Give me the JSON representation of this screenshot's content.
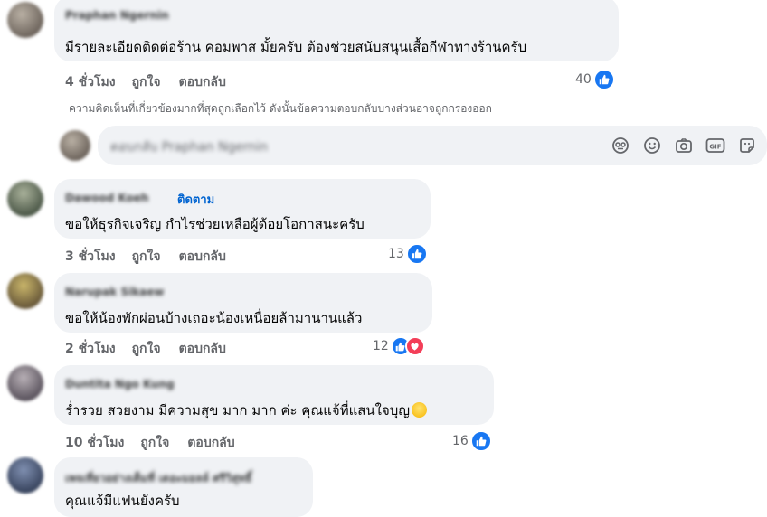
{
  "comments": [
    {
      "author": "Praphan Ngernin",
      "text": "มีรายละเอียดติดต่อร้าน คอมพาส มั้ยครับ ต้องช่วยสนับสนุนเสื้อกีฬาทางร้านครับ",
      "time": "4 ชั่วโมง",
      "like": "ถูกใจ",
      "reply": "ตอบกลับ",
      "reactions": "40"
    },
    {
      "author": "Dawood Koeh",
      "follow": "ติดตาม",
      "text": "ขอให้ธุรกิจเจริญ กำไรช่วยเหลือผู้ด้อยโอกาสนะครับ",
      "time": "3 ชั่วโมง",
      "like": "ถูกใจ",
      "reply": "ตอบกลับ",
      "reactions": "13"
    },
    {
      "author": "Narupak Sikaew",
      "text": "ขอให้น้องพักผ่อนบ้างเถอะน้องเหนื่อยล้ามานานแล้ว",
      "time": "2 ชั่วโมง",
      "like": "ถูกใจ",
      "reply": "ตอบกลับ",
      "reactions": "12"
    },
    {
      "author": "Duntita Ngo Kung",
      "text": "ร่ำรวย สวยงาม มีความสุข มาก มาก ค่ะ คุณแจ้ที่แสนใจบุญ",
      "time": "10 ชั่วโมง",
      "like": "ถูกใจ",
      "reply": "ตอบกลับ",
      "reactions": "16"
    },
    {
      "author": "เพจเที่ยวอย่างเต็มที่ เดอะมอลล์ ศรีวิสุทธิ์",
      "text": "คุณแจ้มีแฟนยังครับ"
    }
  ],
  "notice": "ความคิดเห็นที่เกี่ยวข้องมากที่สุดถูกเลือกไว้ ดังนั้นข้อความตอบกลับบางส่วนอาจถูกกรองออก",
  "reply_box": {
    "placeholder": "ตอบกลับ Praphan Ngernin"
  },
  "toolbar_icons": [
    "avatar-sticker-icon",
    "emoji-icon",
    "camera-icon",
    "gif-icon",
    "sticker-icon"
  ],
  "colors": {
    "bubble": "#f0f2f5",
    "like_blue": "#1877f2",
    "heart_red": "#f33e58",
    "follow_blue": "#0064d1",
    "meta_gray": "#65676b"
  }
}
